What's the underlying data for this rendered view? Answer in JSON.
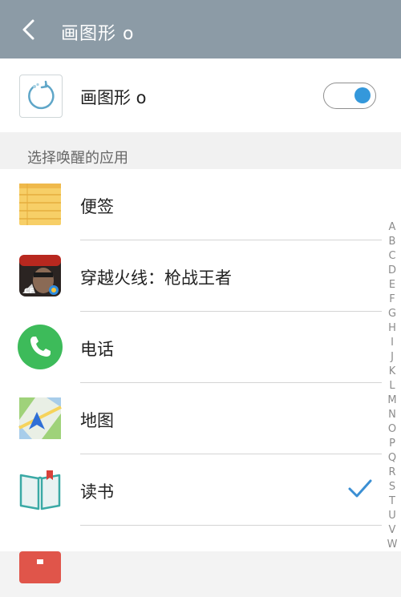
{
  "header": {
    "title": "画图形 o"
  },
  "feature": {
    "label": "画图形 o",
    "enabled": true
  },
  "section": {
    "label": "选择唤醒的应用"
  },
  "apps": [
    {
      "label": "便签",
      "icon": "notepad-icon",
      "selected": false
    },
    {
      "label": "穿越火线：枪战王者",
      "icon": "crossfire-game-icon",
      "selected": false
    },
    {
      "label": "电话",
      "icon": "phone-icon",
      "selected": false
    },
    {
      "label": "地图",
      "icon": "map-icon",
      "selected": false
    },
    {
      "label": "读书",
      "icon": "book-icon",
      "selected": true
    }
  ],
  "alphabet": [
    "A",
    "B",
    "C",
    "D",
    "E",
    "F",
    "G",
    "H",
    "I",
    "J",
    "K",
    "L",
    "M",
    "N",
    "O",
    "P",
    "Q",
    "R",
    "S",
    "T",
    "U",
    "V",
    "W"
  ],
  "colors": {
    "header": "#8c9ba6",
    "accent": "#3498db",
    "phone": "#3dbb5a"
  }
}
